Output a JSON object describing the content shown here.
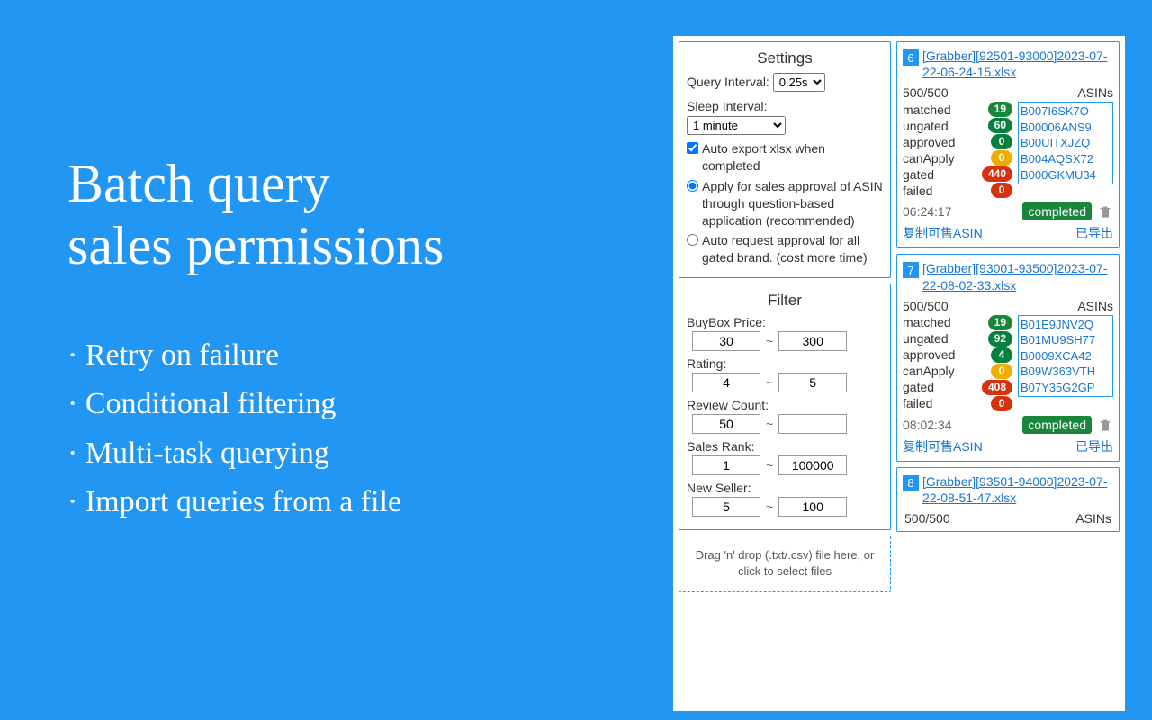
{
  "marketing": {
    "title_line1": "Batch query",
    "title_line2": "sales permissions",
    "bullets": [
      "Retry on failure",
      "Conditional filtering",
      "Multi-task querying",
      "Import queries from a file"
    ]
  },
  "settings": {
    "title": "Settings",
    "query_interval_label": "Query Interval:",
    "query_interval_value": "0.25s",
    "sleep_interval_label": "Sleep Interval:",
    "sleep_interval_value": "1 minute",
    "auto_export_label": "Auto export xlsx when completed",
    "auto_export_checked": true,
    "approval_mode": "question",
    "approval_question_label": "Apply for sales approval of ASIN through question-based application (recommended)",
    "approval_auto_label": "Auto request approval for all gated brand. (cost more time)"
  },
  "filter": {
    "title": "Filter",
    "buybox_label": "BuyBox Price:",
    "buybox_min": "30",
    "buybox_max": "300",
    "rating_label": "Rating:",
    "rating_min": "4",
    "rating_max": "5",
    "review_label": "Review Count:",
    "review_min": "50",
    "review_max": "",
    "rank_label": "Sales Rank:",
    "rank_min": "1",
    "rank_max": "100000",
    "seller_label": "New Seller:",
    "seller_min": "5",
    "seller_max": "100",
    "sep": "~"
  },
  "dropzone": {
    "text": "Drag 'n' drop (.txt/.csv) file here, or click to select files"
  },
  "labels": {
    "asins": "ASINs",
    "matched": "matched",
    "ungated": "ungated",
    "approved": "approved",
    "canApply": "canApply",
    "gated": "gated",
    "failed": "failed",
    "completed": "completed",
    "copy_asin": "复制可售ASIN",
    "exported": "已导出"
  },
  "tasks": [
    {
      "num": "6",
      "link": "[Grabber][92501-93000]2023-07-22-06-24-15.xlsx",
      "count": "500/500",
      "stats": {
        "matched": "19",
        "ungated": "60",
        "approved": "0",
        "canApply": "0",
        "gated": "440",
        "failed": "0"
      },
      "asins": [
        "B007I6SK7O",
        "B00006ANS9",
        "B00UITXJZQ",
        "B004AQSX72",
        "B000GKMU34"
      ],
      "time": "06:24:17"
    },
    {
      "num": "7",
      "link": "[Grabber][93001-93500]2023-07-22-08-02-33.xlsx",
      "count": "500/500",
      "stats": {
        "matched": "19",
        "ungated": "92",
        "approved": "4",
        "canApply": "0",
        "gated": "408",
        "failed": "0"
      },
      "asins": [
        "B01E9JNV2Q",
        "B01MU9SH77",
        "B0009XCA42",
        "B09W363VTH",
        "B07Y35G2GP"
      ],
      "time": "08:02:34"
    },
    {
      "num": "8",
      "link": "[Grabber][93501-94000]2023-07-22-08-51-47.xlsx",
      "count": "500/500",
      "partial": true
    }
  ]
}
